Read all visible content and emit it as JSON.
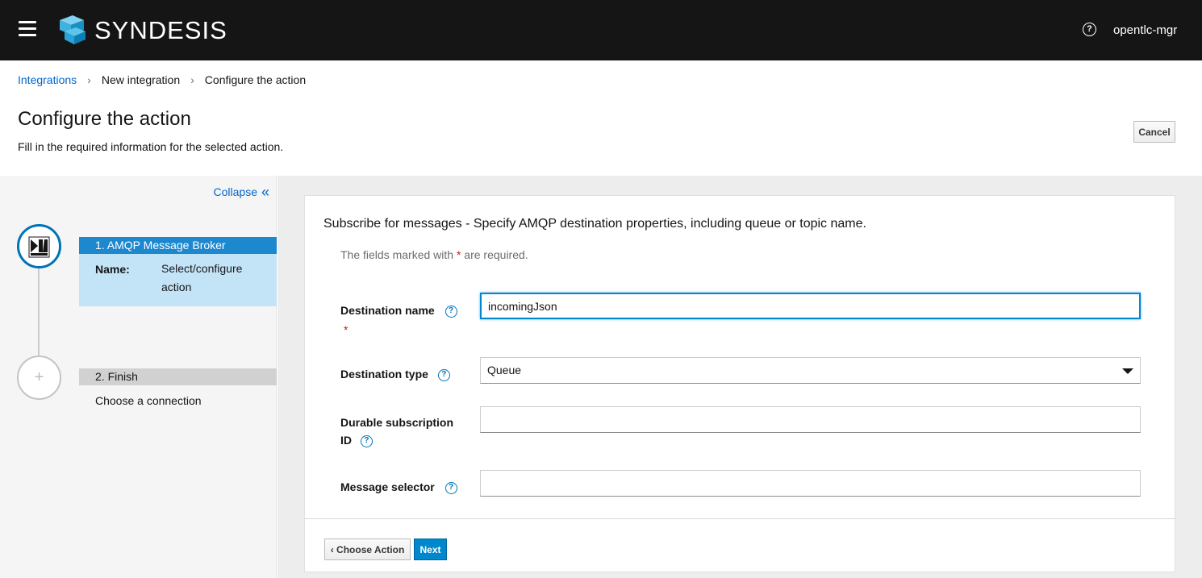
{
  "header": {
    "brand": "SYNDESIS",
    "user": "opentlc-mgr",
    "icons": {
      "menu": "hamburger-icon",
      "help": "help-circle-icon",
      "logo": "syndesis-logo-icon"
    }
  },
  "breadcrumb": {
    "items": [
      "Integrations",
      "New integration",
      "Configure the action"
    ]
  },
  "page": {
    "title": "Configure the action",
    "subtitle": "Fill in the required information for the selected action.",
    "cancel_label": "Cancel"
  },
  "sidebar": {
    "collapse_label": "Collapse",
    "steps": [
      {
        "header": "1. AMQP Message Broker",
        "name_label": "Name:",
        "name_value": "Select/configure action",
        "icon": "amqp-connector-icon"
      },
      {
        "header": "2. Finish",
        "description": "Choose a connection",
        "icon": "plus-icon"
      }
    ]
  },
  "form": {
    "title": "Subscribe for messages - Specify AMQP destination properties, including queue or topic name.",
    "required_note_prefix": "The fields marked with",
    "required_star": "*",
    "required_note_suffix": "are required.",
    "fields": [
      {
        "label": "Destination name",
        "value": "incomingJson",
        "required": true
      },
      {
        "label": "Destination type",
        "value": "Queue"
      },
      {
        "label_line1": "Durable subscription",
        "label_line2": "ID",
        "value": ""
      },
      {
        "label": "Message selector",
        "value": ""
      }
    ]
  },
  "footer": {
    "back_label": "Choose Action",
    "next_label": "Next"
  },
  "colors": {
    "topbar": "#151515",
    "link": "#0066cc",
    "primary": "#0088ce",
    "step_active": "#1e88cf",
    "step_active_body": "#c3e4f7"
  }
}
